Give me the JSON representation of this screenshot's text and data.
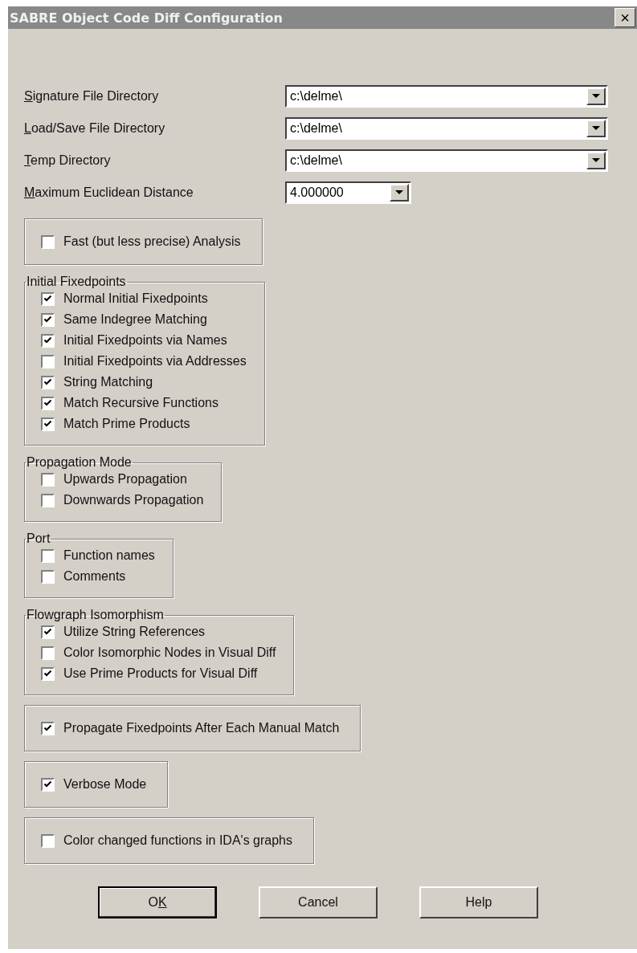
{
  "window": {
    "title": "SABRE Object Code Diff Configuration",
    "close": "×"
  },
  "fields": [
    {
      "label": "Signature File Directory",
      "underline_first": true,
      "value": "c:\\delme\\",
      "kind": "path"
    },
    {
      "label": "Load/Save File Directory",
      "underline_first": true,
      "value": "c:\\delme\\",
      "kind": "path"
    },
    {
      "label": "Temp Directory",
      "underline_first": true,
      "value": "c:\\delme\\",
      "kind": "path"
    },
    {
      "label": "Maximum Euclidean Distance",
      "underline_first": true,
      "value": "4.000000",
      "kind": "number"
    }
  ],
  "groups": [
    {
      "options": [
        {
          "label": "Fast (but less precise) Analysis",
          "checked": false
        }
      ]
    },
    {
      "title": "Initial Fixedpoints",
      "options": [
        {
          "label": "Normal Initial Fixedpoints",
          "checked": true
        },
        {
          "label": "Same Indegree Matching",
          "checked": true
        },
        {
          "label": "Initial Fixedpoints via Names",
          "checked": true
        },
        {
          "label": "Initial Fixedpoints via Addresses",
          "checked": false
        },
        {
          "label": "String Matching",
          "checked": true
        },
        {
          "label": "Match Recursive Functions",
          "checked": true
        },
        {
          "label": "Match Prime Products",
          "checked": true
        }
      ]
    },
    {
      "title": "Propagation Mode",
      "options": [
        {
          "label": "Upwards Propagation",
          "checked": false
        },
        {
          "label": "Downwards Propagation",
          "checked": false
        }
      ]
    },
    {
      "title": "Port",
      "options": [
        {
          "label": "Function names",
          "checked": false
        },
        {
          "label": "Comments",
          "checked": false
        }
      ]
    },
    {
      "title": "Flowgraph Isomorphism",
      "options": [
        {
          "label": "Utilize String References",
          "checked": true
        },
        {
          "label": "Color Isomorphic Nodes in Visual Diff",
          "checked": false
        },
        {
          "label": "Use Prime Products for Visual Diff",
          "checked": true
        }
      ]
    },
    {
      "options": [
        {
          "label": "Propagate Fixedpoints After Each Manual Match",
          "checked": true
        }
      ]
    },
    {
      "options": [
        {
          "label": "Verbose Mode",
          "checked": true
        }
      ]
    },
    {
      "options": [
        {
          "label": "Color changed functions in IDA's graphs",
          "checked": false
        }
      ]
    }
  ],
  "buttons": [
    {
      "label": "OK",
      "underline_last": true,
      "default": true
    },
    {
      "label": "Cancel",
      "underline_last": false,
      "default": false
    },
    {
      "label": "Help",
      "underline_last": false,
      "default": false
    }
  ]
}
